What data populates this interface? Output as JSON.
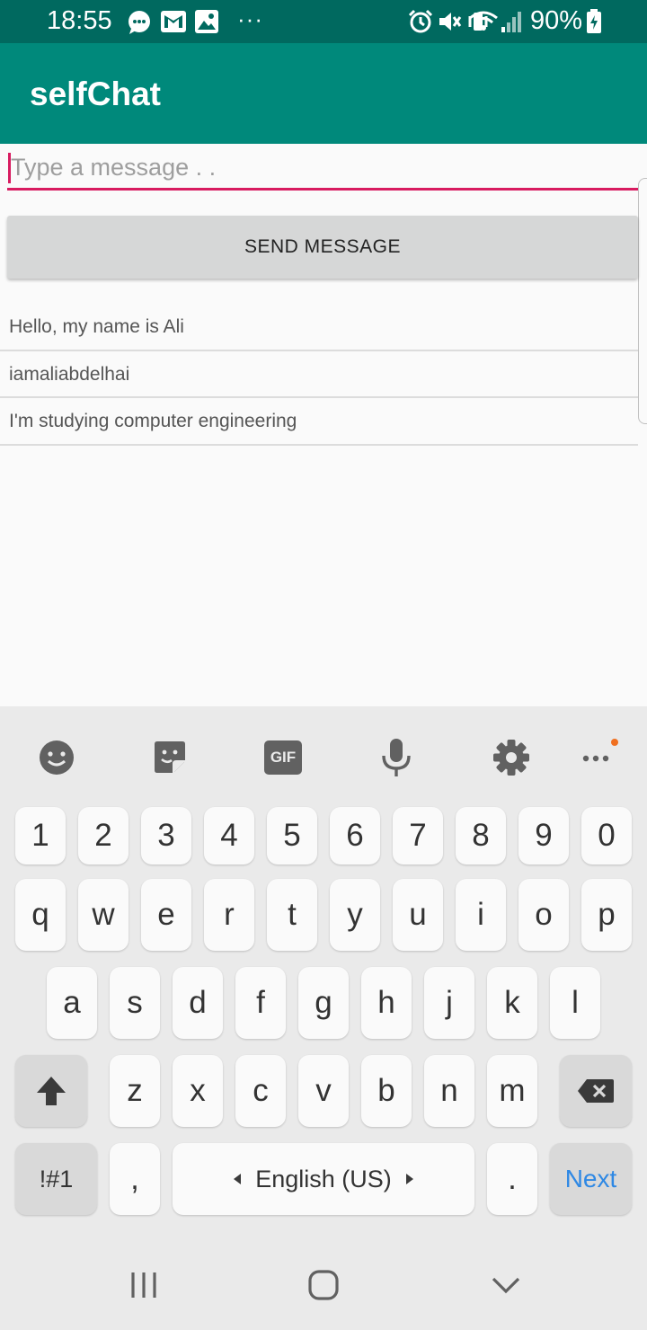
{
  "status_bar": {
    "time": "18:55",
    "more": "···",
    "battery": "90%",
    "left_icons": [
      "chat-bubble-icon",
      "mail-icon",
      "image-icon"
    ],
    "right_icons": [
      "alarm-icon",
      "mute-icon",
      "vibrate-icon",
      "wifi-icon",
      "signal-icon",
      "battery-icon"
    ]
  },
  "app": {
    "title": "selfChat"
  },
  "composer": {
    "placeholder": "Type a message . .",
    "value": "",
    "send_label": "SEND MESSAGE"
  },
  "messages": [
    "Hello, my name is Ali",
    "iamaliabdelhai",
    "I'm studying computer engineering"
  ],
  "keyboard": {
    "toolbar": [
      "emoji-icon",
      "sticker-icon",
      "gif-icon",
      "microphone-icon",
      "settings-icon",
      "more-icon"
    ],
    "gif": "GIF",
    "numbers": [
      "1",
      "2",
      "3",
      "4",
      "5",
      "6",
      "7",
      "8",
      "9",
      "0"
    ],
    "row1": [
      "q",
      "w",
      "e",
      "r",
      "t",
      "y",
      "u",
      "i",
      "o",
      "p"
    ],
    "row2": [
      "a",
      "s",
      "d",
      "f",
      "g",
      "h",
      "j",
      "k",
      "l"
    ],
    "row3": [
      "z",
      "x",
      "c",
      "v",
      "b",
      "n",
      "m"
    ],
    "symbols": "!#1",
    "comma": ",",
    "language": "English (US)",
    "period": ".",
    "action": "Next"
  },
  "colors": {
    "status_bar": "#00695f",
    "app_bar": "#00897b",
    "accent": "#d81b60",
    "next_key": "#2e88e4",
    "notification_dot": "#f07020"
  }
}
